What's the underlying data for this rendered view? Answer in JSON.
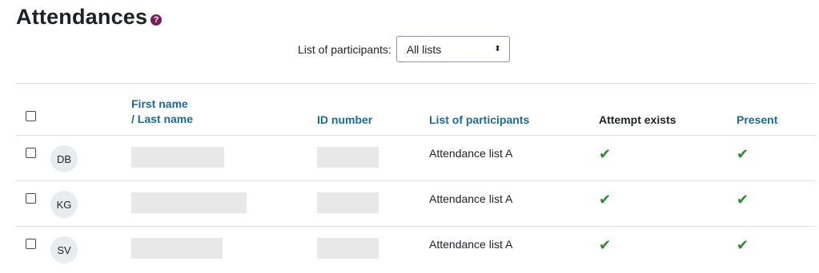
{
  "page": {
    "title": "Attendances"
  },
  "filter": {
    "label": "List of participants:",
    "selected": "All lists"
  },
  "table": {
    "headers": {
      "first_name": "First name",
      "last_name": "/ Last name",
      "id_number": "ID number",
      "list": "List of participants",
      "attempt": "Attempt exists",
      "present": "Present"
    },
    "rows": [
      {
        "initials": "DB",
        "list": "Attendance list A",
        "attempt": "✔",
        "present": "✔",
        "name_redact": 0.5,
        "id_redact": 0.55
      },
      {
        "initials": "KG",
        "list": "Attendance list A",
        "attempt": "✔",
        "present": "✔",
        "name_redact": 0.62,
        "id_redact": 0.55
      },
      {
        "initials": "SV",
        "list": "Attendance list A",
        "attempt": "✔",
        "present": "✔",
        "name_redact": 0.49,
        "id_redact": 0.55
      }
    ]
  },
  "colors": {
    "link": "#1a6b99",
    "check": "#2e8b2e",
    "help_icon": "#7b1d5c"
  }
}
